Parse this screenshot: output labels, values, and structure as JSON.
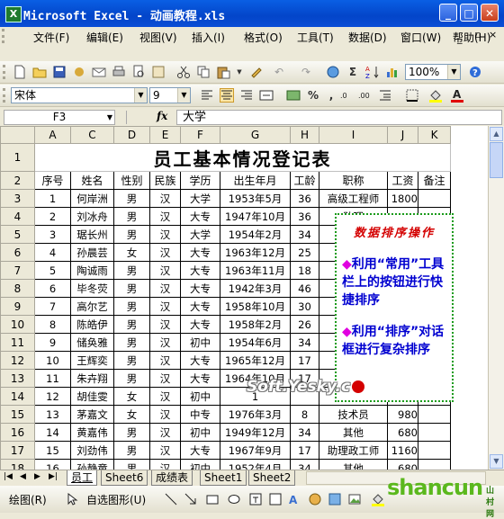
{
  "window": {
    "title": "Microsoft Excel - 动画教程.xls",
    "app_icon": "X",
    "min": "_",
    "max": "□",
    "close": "✕"
  },
  "menu": [
    {
      "label": "文件(F)"
    },
    {
      "label": "编辑(E)"
    },
    {
      "label": "视图(V)"
    },
    {
      "label": "插入(I)"
    },
    {
      "label": "格式(O)"
    },
    {
      "label": "工具(T)"
    },
    {
      "label": "数据(D)"
    },
    {
      "label": "窗口(W)"
    },
    {
      "label": "帮助(H)"
    }
  ],
  "menu_doc_buttons": {
    "min": "_",
    "restore": "▫",
    "close": "×"
  },
  "toolbar": {
    "zoom": "100%",
    "font": "宋体",
    "size": "9",
    "percent": "%",
    "comma": ","
  },
  "formula_bar": {
    "cell": "F3",
    "fx": "fx",
    "value": "大学"
  },
  "columns": [
    "A",
    "C",
    "D",
    "E",
    "F",
    "G",
    "H",
    "I",
    "J",
    "K"
  ],
  "sheet": {
    "title": "员工基本情况登记表",
    "headers": [
      "序号",
      "姓名",
      "性别",
      "民族",
      "学历",
      "出生年月",
      "工龄",
      "职称",
      "工资",
      "备注"
    ],
    "rows": [
      [
        "1",
        "何岸洲",
        "男",
        "汉",
        "大学",
        "1953年5月",
        "36",
        "高级工程师",
        "1800",
        ""
      ],
      [
        "2",
        "刘冰舟",
        "男",
        "汉",
        "大专",
        "1947年10月",
        "36",
        "助理",
        "",
        ""
      ],
      [
        "3",
        "琚长州",
        "男",
        "汉",
        "大学",
        "1954年2月",
        "34",
        "高级",
        "",
        ""
      ],
      [
        "4",
        "孙晨芸",
        "女",
        "汉",
        "大专",
        "1963年12月",
        "25",
        "",
        "",
        ""
      ],
      [
        "5",
        "陶诚雨",
        "男",
        "汉",
        "大专",
        "1963年11月",
        "18",
        "",
        "",
        ""
      ],
      [
        "6",
        "毕冬荧",
        "男",
        "汉",
        "大专",
        "1942年3月",
        "46",
        "",
        "",
        ""
      ],
      [
        "7",
        "高尔艺",
        "男",
        "汉",
        "大专",
        "1958年10月",
        "30",
        "助",
        "",
        ""
      ],
      [
        "8",
        "陈皓伊",
        "男",
        "汉",
        "大专",
        "1958年2月",
        "26",
        "",
        "",
        ""
      ],
      [
        "9",
        "储奂雅",
        "男",
        "汉",
        "初中",
        "1954年6月",
        "34",
        "",
        "",
        ""
      ],
      [
        "10",
        "王辉奕",
        "男",
        "汉",
        "大专",
        "1965年12月",
        "17",
        "",
        "",
        ""
      ],
      [
        "11",
        "朱卉翔",
        "男",
        "汉",
        "大专",
        "1964年10月",
        "17",
        "助",
        "",
        ""
      ],
      [
        "12",
        "胡佳雯",
        "女",
        "汉",
        "初中",
        "1",
        "",
        "",
        "",
        ""
      ],
      [
        "13",
        "茅嘉文",
        "女",
        "汉",
        "中专",
        "1976年3月",
        "8",
        "技术员",
        "980",
        ""
      ],
      [
        "14",
        "黄嘉伟",
        "男",
        "汉",
        "初中",
        "1949年12月",
        "34",
        "其他",
        "680",
        ""
      ],
      [
        "15",
        "刘劲伟",
        "男",
        "汉",
        "大专",
        "1967年9月",
        "17",
        "助理政工师",
        "1160",
        ""
      ],
      [
        "16",
        "孙静童",
        "男",
        "汉",
        "初中",
        "1952年4月",
        "34",
        "其他",
        "680",
        ""
      ]
    ],
    "row_numbers": [
      "1",
      "2",
      "3",
      "4",
      "5",
      "6",
      "7",
      "8",
      "9",
      "10",
      "11",
      "12",
      "13",
      "14",
      "15",
      "16",
      "17",
      "18"
    ]
  },
  "callout": {
    "title": "数据排序操作",
    "bullet1": "利用“常用”工具栏上的按钮进行快捷排序",
    "bullet2": "利用“排序”对话框进行复杂排序",
    "bullet_icon": "◆"
  },
  "watermark": "Soft.Yesky.c",
  "tabs": [
    {
      "label": "员工",
      "active": true
    },
    {
      "label": "Sheet6",
      "active": false
    },
    {
      "label": "成绩表",
      "active": false
    },
    {
      "label": "Sheet1",
      "active": false
    },
    {
      "label": "Sheet2",
      "active": false
    }
  ],
  "tab_nav": [
    "|◀",
    "◀",
    "▶",
    "▶|"
  ],
  "drawing_toolbar": {
    "draw_label": "绘图(R)",
    "autoshape_label": "自选图形(U)"
  },
  "logo": "shancun",
  "logo_sub": "山村网"
}
